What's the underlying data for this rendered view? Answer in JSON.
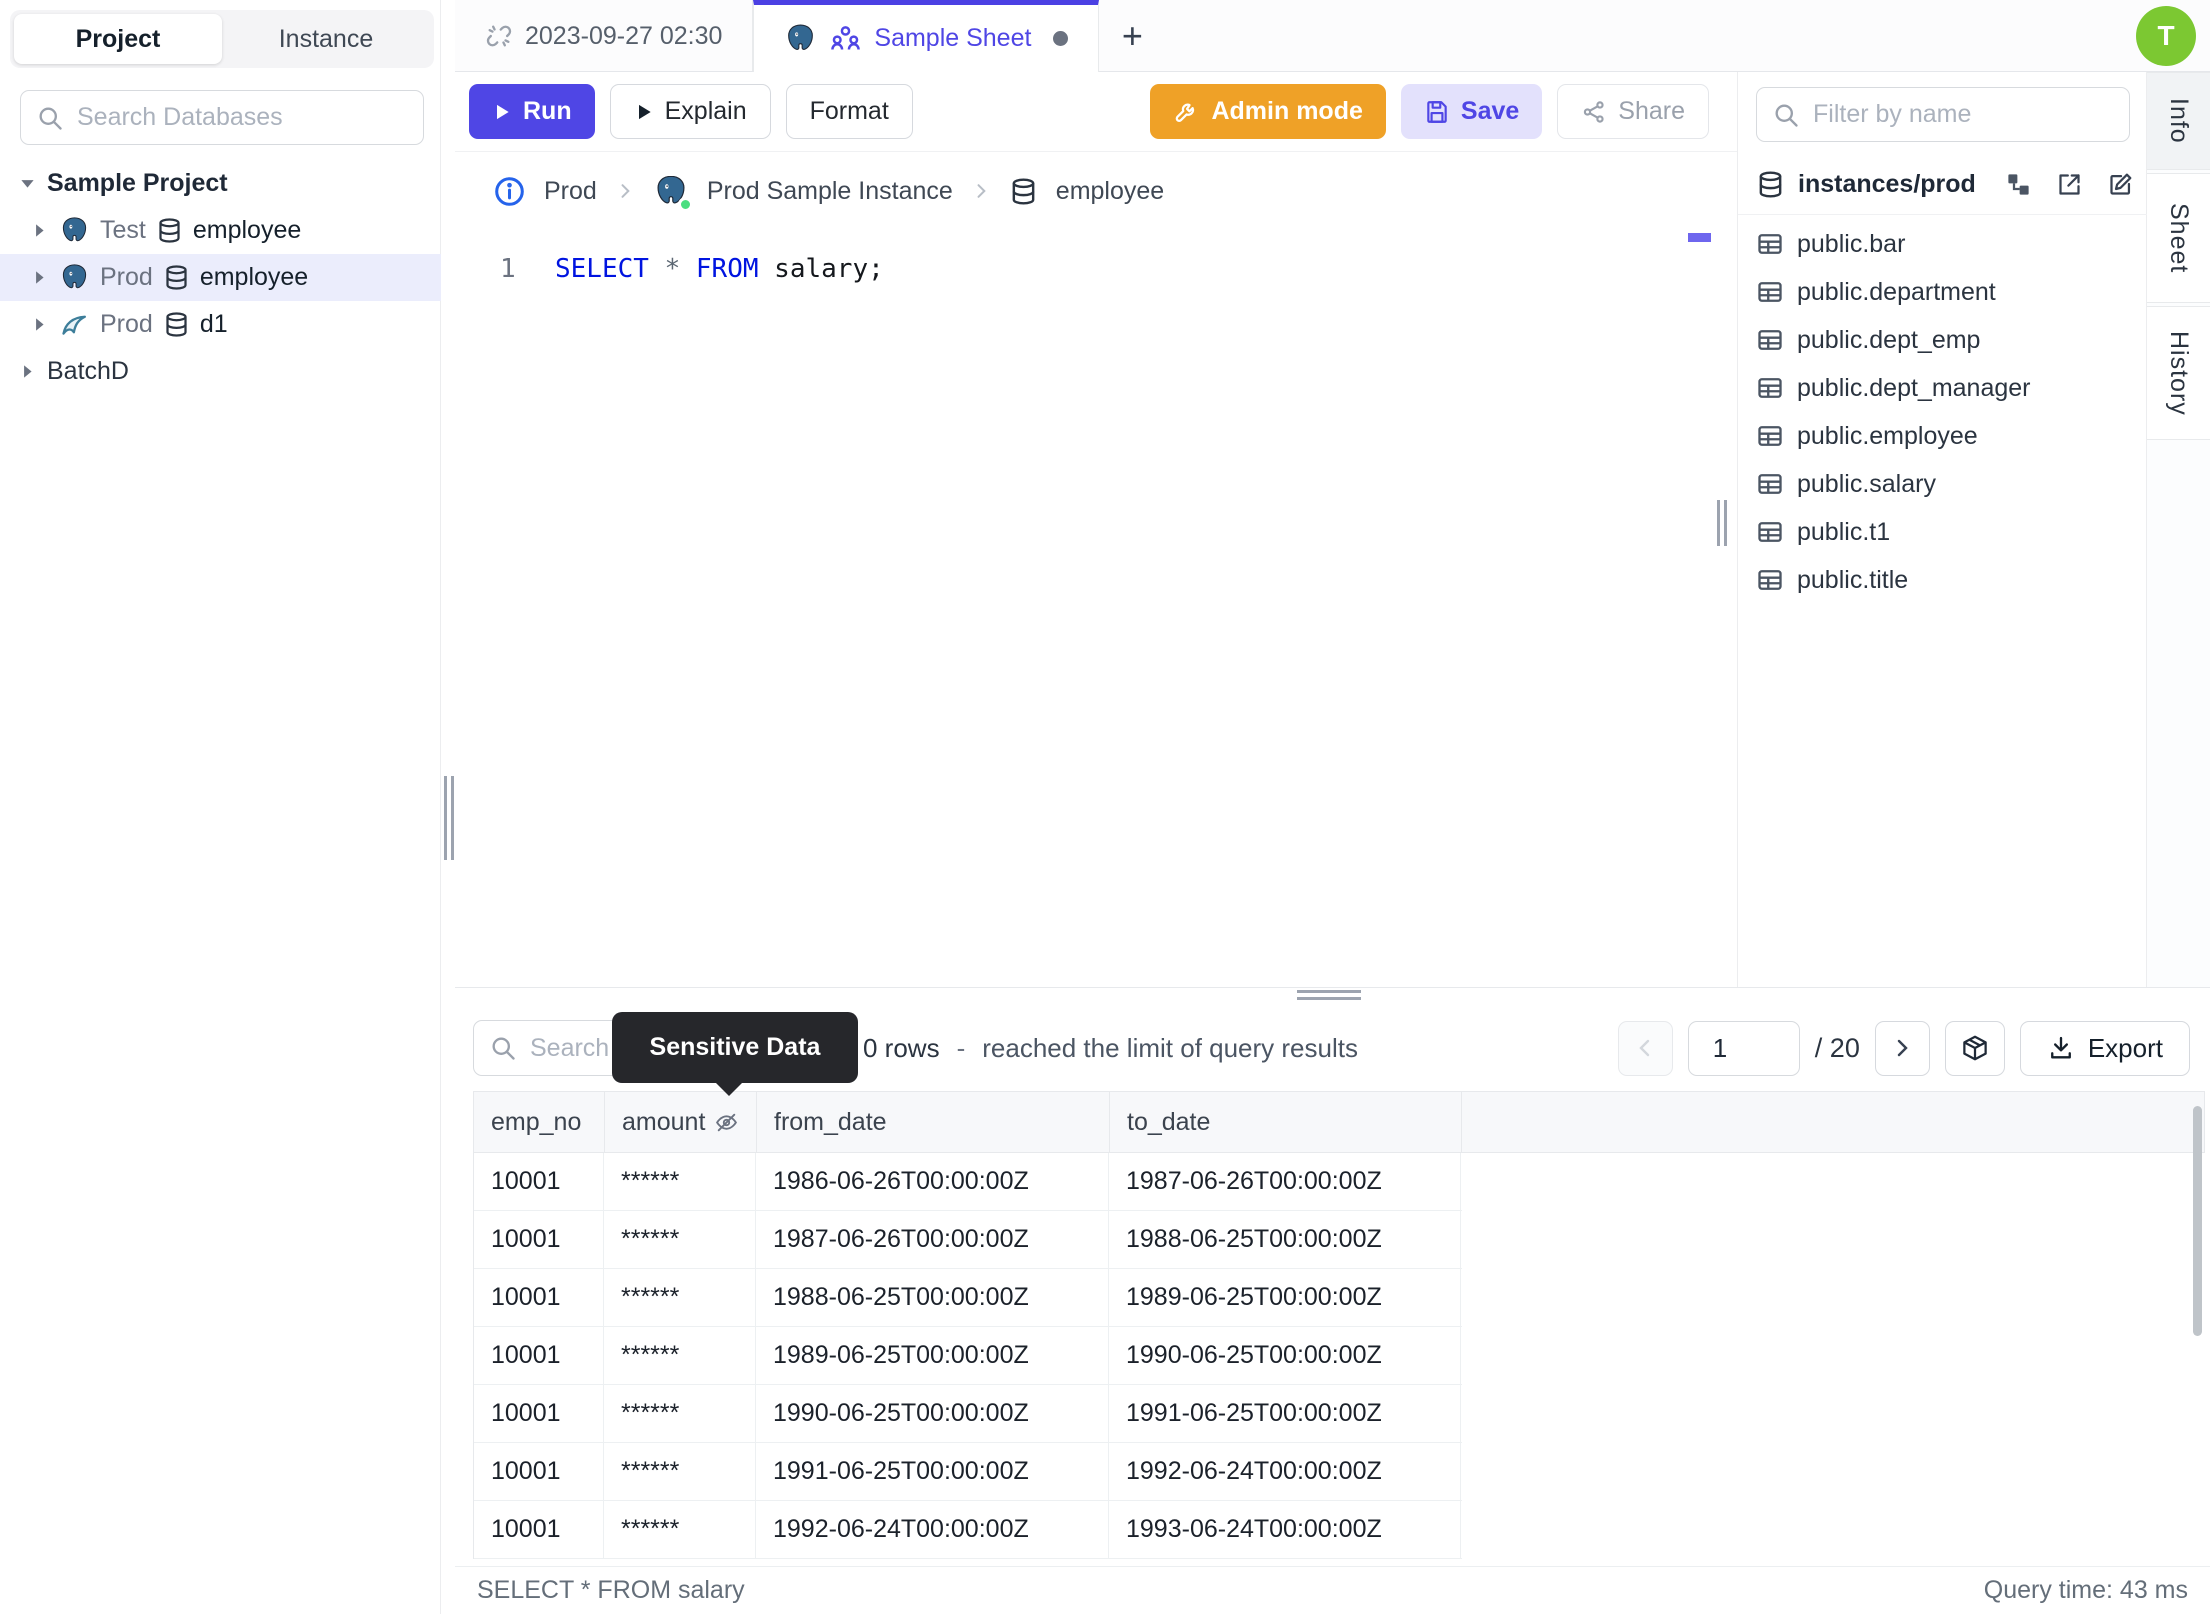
{
  "app": {
    "avatar_initial": "T"
  },
  "left_sidebar": {
    "toggle": {
      "project": "Project",
      "instance": "Instance"
    },
    "search_placeholder": "Search Databases",
    "tree": {
      "root_label": "Sample Project",
      "items": [
        {
          "env": "Test",
          "db": "employee",
          "engine": "postgres"
        },
        {
          "env": "Prod",
          "db": "employee",
          "engine": "postgres"
        },
        {
          "env": "Prod",
          "db": "d1",
          "engine": "mysql"
        }
      ],
      "batch_label": "BatchD"
    }
  },
  "tab_bar": {
    "tab1": "2023-09-27 02:30",
    "tab2": "Sample Sheet",
    "new_tab": "+"
  },
  "toolbar": {
    "run": "Run",
    "explain": "Explain",
    "format": "Format",
    "admin_mode": "Admin mode",
    "save": "Save",
    "share": "Share"
  },
  "breadcrumb": {
    "env": "Prod",
    "instance": "Prod Sample Instance",
    "database": "employee"
  },
  "editor": {
    "line_number": "1",
    "tokens": [
      {
        "text": "SELECT",
        "type": "keyword"
      },
      {
        "text": " ",
        "type": "plain"
      },
      {
        "text": "*",
        "type": "operator"
      },
      {
        "text": " ",
        "type": "plain"
      },
      {
        "text": "FROM",
        "type": "keyword"
      },
      {
        "text": " ",
        "type": "plain"
      },
      {
        "text": "salary;",
        "type": "plain"
      }
    ]
  },
  "schema_panel": {
    "filter_placeholder": "Filter by name",
    "database_label": "instances/prod",
    "tables": [
      "public.bar",
      "public.department",
      "public.dept_emp",
      "public.dept_manager",
      "public.employee",
      "public.salary",
      "public.t1",
      "public.title"
    ]
  },
  "side_tabs": [
    "Info",
    "Sheet",
    "History"
  ],
  "results": {
    "search_placeholder": "Search",
    "tooltip": "Sensitive Data",
    "rows_summary": "0 rows",
    "summary_separator": "-",
    "summary_text": "reached the limit of query results",
    "page_value": "1",
    "page_total": "/ 20",
    "export_label": "Export",
    "columns": [
      "emp_no",
      "amount",
      "from_date",
      "to_date"
    ],
    "rows": [
      [
        "10001",
        "******",
        "1986-06-26T00:00:00Z",
        "1987-06-26T00:00:00Z"
      ],
      [
        "10001",
        "******",
        "1987-06-26T00:00:00Z",
        "1988-06-25T00:00:00Z"
      ],
      [
        "10001",
        "******",
        "1988-06-25T00:00:00Z",
        "1989-06-25T00:00:00Z"
      ],
      [
        "10001",
        "******",
        "1989-06-25T00:00:00Z",
        "1990-06-25T00:00:00Z"
      ],
      [
        "10001",
        "******",
        "1990-06-25T00:00:00Z",
        "1991-06-25T00:00:00Z"
      ],
      [
        "10001",
        "******",
        "1991-06-25T00:00:00Z",
        "1992-06-24T00:00:00Z"
      ],
      [
        "10001",
        "******",
        "1992-06-24T00:00:00Z",
        "1993-06-24T00:00:00Z"
      ]
    ],
    "status_query": "SELECT * FROM salary",
    "status_time": "Query time: 43 ms"
  },
  "colors": {
    "accent_indigo": "#4f46e5",
    "admin_orange": "#efa127",
    "save_bg": "#e3e1fc",
    "avatar_green": "#7cc832",
    "tree_selection": "#ebedfc",
    "tooltip_bg": "#26272b",
    "keyword_blue": "#0014e0",
    "postgres_blue": "#336791",
    "status_green": "#4ade80"
  }
}
